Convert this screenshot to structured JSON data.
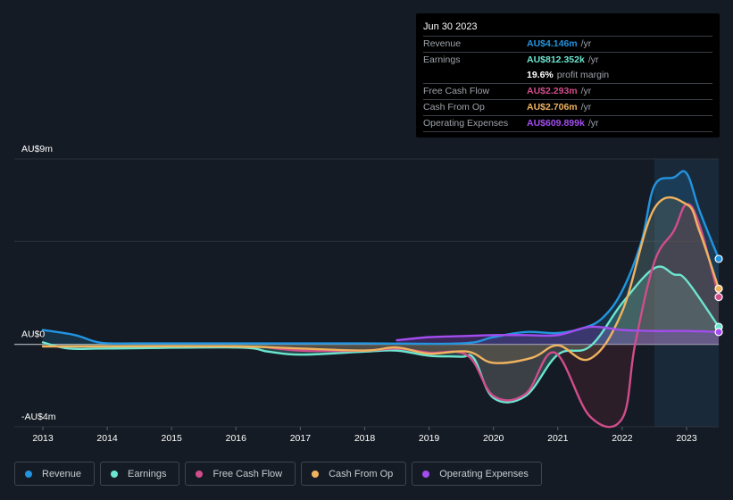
{
  "tooltip": {
    "date": "Jun 30 2023",
    "rows": [
      {
        "label": "Revenue",
        "value": "AU$4.146m",
        "unit": "/yr",
        "color": "#2394df"
      },
      {
        "label": "Earnings",
        "value": "AU$812.352k",
        "unit": "/yr",
        "color": "#6ce5d0"
      },
      {
        "label": "",
        "value": "19.6%",
        "unit": "profit margin",
        "color": "#ffffff"
      },
      {
        "label": "Free Cash Flow",
        "value": "AU$2.293m",
        "unit": "/yr",
        "color": "#d14d8b"
      },
      {
        "label": "Cash From Op",
        "value": "AU$2.706m",
        "unit": "/yr",
        "color": "#f0b35f"
      },
      {
        "label": "Operating Expenses",
        "value": "AU$609.899k",
        "unit": "/yr",
        "color": "#a34df0"
      }
    ]
  },
  "legend": [
    {
      "label": "Revenue",
      "color": "#2394df"
    },
    {
      "label": "Earnings",
      "color": "#6ce5d0"
    },
    {
      "label": "Free Cash Flow",
      "color": "#d14d8b"
    },
    {
      "label": "Cash From Op",
      "color": "#f0b35f"
    },
    {
      "label": "Operating Expenses",
      "color": "#a34df0"
    }
  ],
  "chart_data": {
    "type": "area",
    "title": "",
    "xlabel": "",
    "ylabel": "",
    "unit": "AU$m",
    "ylim": [
      -4,
      9
    ],
    "xlim": [
      2012.75,
      2023.5
    ],
    "y_tick_labels": [
      {
        "value": 9,
        "label": "AU$9m"
      },
      {
        "value": 0,
        "label": "AU$0"
      },
      {
        "value": -4,
        "label": "-AU$4m"
      }
    ],
    "gridlines": [
      9,
      5,
      0,
      -4
    ],
    "x_ticks": [
      2013,
      2014,
      2015,
      2016,
      2017,
      2018,
      2019,
      2020,
      2021,
      2022,
      2023
    ],
    "highlight_range": [
      2022.5,
      2023.5
    ],
    "grid": true,
    "legend_position": "bottom",
    "series": [
      {
        "name": "Revenue",
        "color": "#2394df",
        "x": [
          2013,
          2013.5,
          2013.9,
          2014.5,
          2016,
          2018,
          2019.5,
          2020,
          2020.5,
          2021,
          2021.4,
          2021.7,
          2022,
          2022.3,
          2022.5,
          2022.8,
          2023,
          2023.2,
          2023.5
        ],
        "y": [
          0.7,
          0.45,
          0.08,
          0.05,
          0.05,
          0.05,
          0.05,
          0.35,
          0.6,
          0.55,
          0.8,
          1.3,
          2.6,
          5.0,
          7.7,
          8.1,
          8.3,
          6.5,
          4.15
        ]
      },
      {
        "name": "Earnings",
        "color": "#6ce5d0",
        "x": [
          2013,
          2013.4,
          2014,
          2016,
          2016.5,
          2017,
          2018,
          2018.5,
          2019,
          2019.5,
          2019.7,
          2020,
          2020.5,
          2021,
          2021.5,
          2022,
          2022.5,
          2022.8,
          2023,
          2023.5
        ],
        "y": [
          0.1,
          -0.2,
          -0.2,
          -0.15,
          -0.35,
          -0.5,
          -0.35,
          -0.3,
          -0.55,
          -0.6,
          -0.7,
          -2.6,
          -2.5,
          -0.5,
          -0.1,
          2.0,
          3.7,
          3.4,
          3.1,
          0.85
        ]
      },
      {
        "name": "Free Cash Flow",
        "color": "#d14d8b",
        "x": [
          2016.5,
          2017,
          2018,
          2018.5,
          2019,
          2019.6,
          2020,
          2020.5,
          2020.95,
          2021.5,
          2022,
          2022.2,
          2022.5,
          2022.8,
          2023,
          2023.2,
          2023.5
        ],
        "y": [
          -0.15,
          -0.3,
          -0.3,
          -0.2,
          -0.4,
          -0.55,
          -2.5,
          -2.4,
          -0.4,
          -3.5,
          -3.6,
          0.0,
          4.0,
          5.5,
          6.8,
          5.8,
          2.3
        ]
      },
      {
        "name": "Cash From Op",
        "color": "#f0b35f",
        "x": [
          2013,
          2014,
          2016,
          2017,
          2018,
          2018.5,
          2019,
          2019.6,
          2020,
          2020.6,
          2021,
          2021.5,
          2022,
          2022.5,
          2023,
          2023.2,
          2023.5
        ],
        "y": [
          -0.1,
          -0.1,
          -0.1,
          -0.2,
          -0.3,
          -0.15,
          -0.45,
          -0.35,
          -0.9,
          -0.65,
          -0.05,
          -0.7,
          1.6,
          6.6,
          6.8,
          5.5,
          2.7
        ]
      },
      {
        "name": "Operating Expenses",
        "color": "#a34df0",
        "x": [
          2018.5,
          2019,
          2019.5,
          2020,
          2020.5,
          2021,
          2021.5,
          2022,
          2022.5,
          2023,
          2023.5
        ],
        "y": [
          0.2,
          0.35,
          0.4,
          0.45,
          0.45,
          0.45,
          0.85,
          0.7,
          0.65,
          0.65,
          0.6
        ]
      }
    ]
  }
}
